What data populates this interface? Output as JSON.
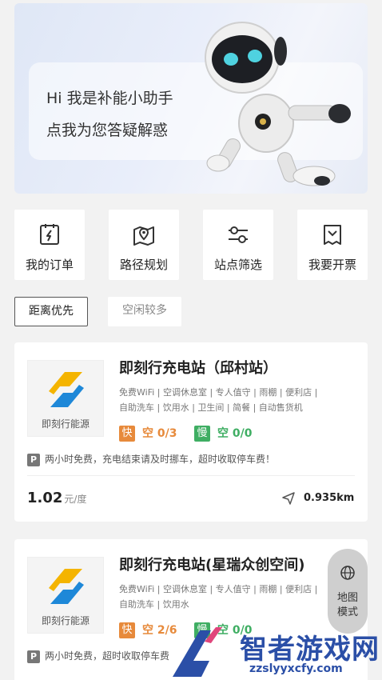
{
  "banner": {
    "line1": "Hi 我是补能小助手",
    "line2": "点我为您答疑解惑"
  },
  "actions": [
    {
      "label": "我的订单",
      "icon": "order-icon"
    },
    {
      "label": "路径规划",
      "icon": "map-route-icon"
    },
    {
      "label": "站点筛选",
      "icon": "filter-icon"
    },
    {
      "label": "我要开票",
      "icon": "invoice-icon"
    }
  ],
  "filters": {
    "sort_distance": "距离优先",
    "sort_idle": "空闲较多"
  },
  "stations": [
    {
      "name": "即刻行充电站（邱村站）",
      "logo_text": "即刻行能源",
      "amenities_line1": "免费WiFi | 空调休息室 | 专人值守 | 雨棚 | 便利店 |",
      "amenities_line2": "自助洗车 | 饮用水 | 卫生间 | 简餐 | 自动售货机",
      "fast_label": "快",
      "fast_avail": "空 0/3",
      "slow_label": "慢",
      "slow_avail": "空 0/0",
      "parking_badge": "P",
      "parking_note": "两小时免费，充电结束请及时挪车，超时收取停车费！",
      "price": "1.02",
      "price_unit": "元/度",
      "distance": "0.935km"
    },
    {
      "name": "即刻行充电站(星瑞众创空间)",
      "logo_text": "即刻行能源",
      "amenities_line1": "免费WiFi | 空调休息室 | 专人值守 | 雨棚 | 便利店 |",
      "amenities_line2": "自助洗车 | 饮用水",
      "fast_label": "快",
      "fast_avail": "空 2/6",
      "slow_label": "慢",
      "slow_avail": "空 0/0",
      "parking_badge": "P",
      "parking_note": "两小时免费，超时收取停车费"
    }
  ],
  "map_mode": {
    "line1": "地图",
    "line2": "模式"
  },
  "watermark": {
    "title": "智者游戏网",
    "url": "zzslyyxcfy.com"
  },
  "colors": {
    "fast": "#e78a3b",
    "slow": "#3fae63",
    "watermark": "#2b4fa7"
  }
}
